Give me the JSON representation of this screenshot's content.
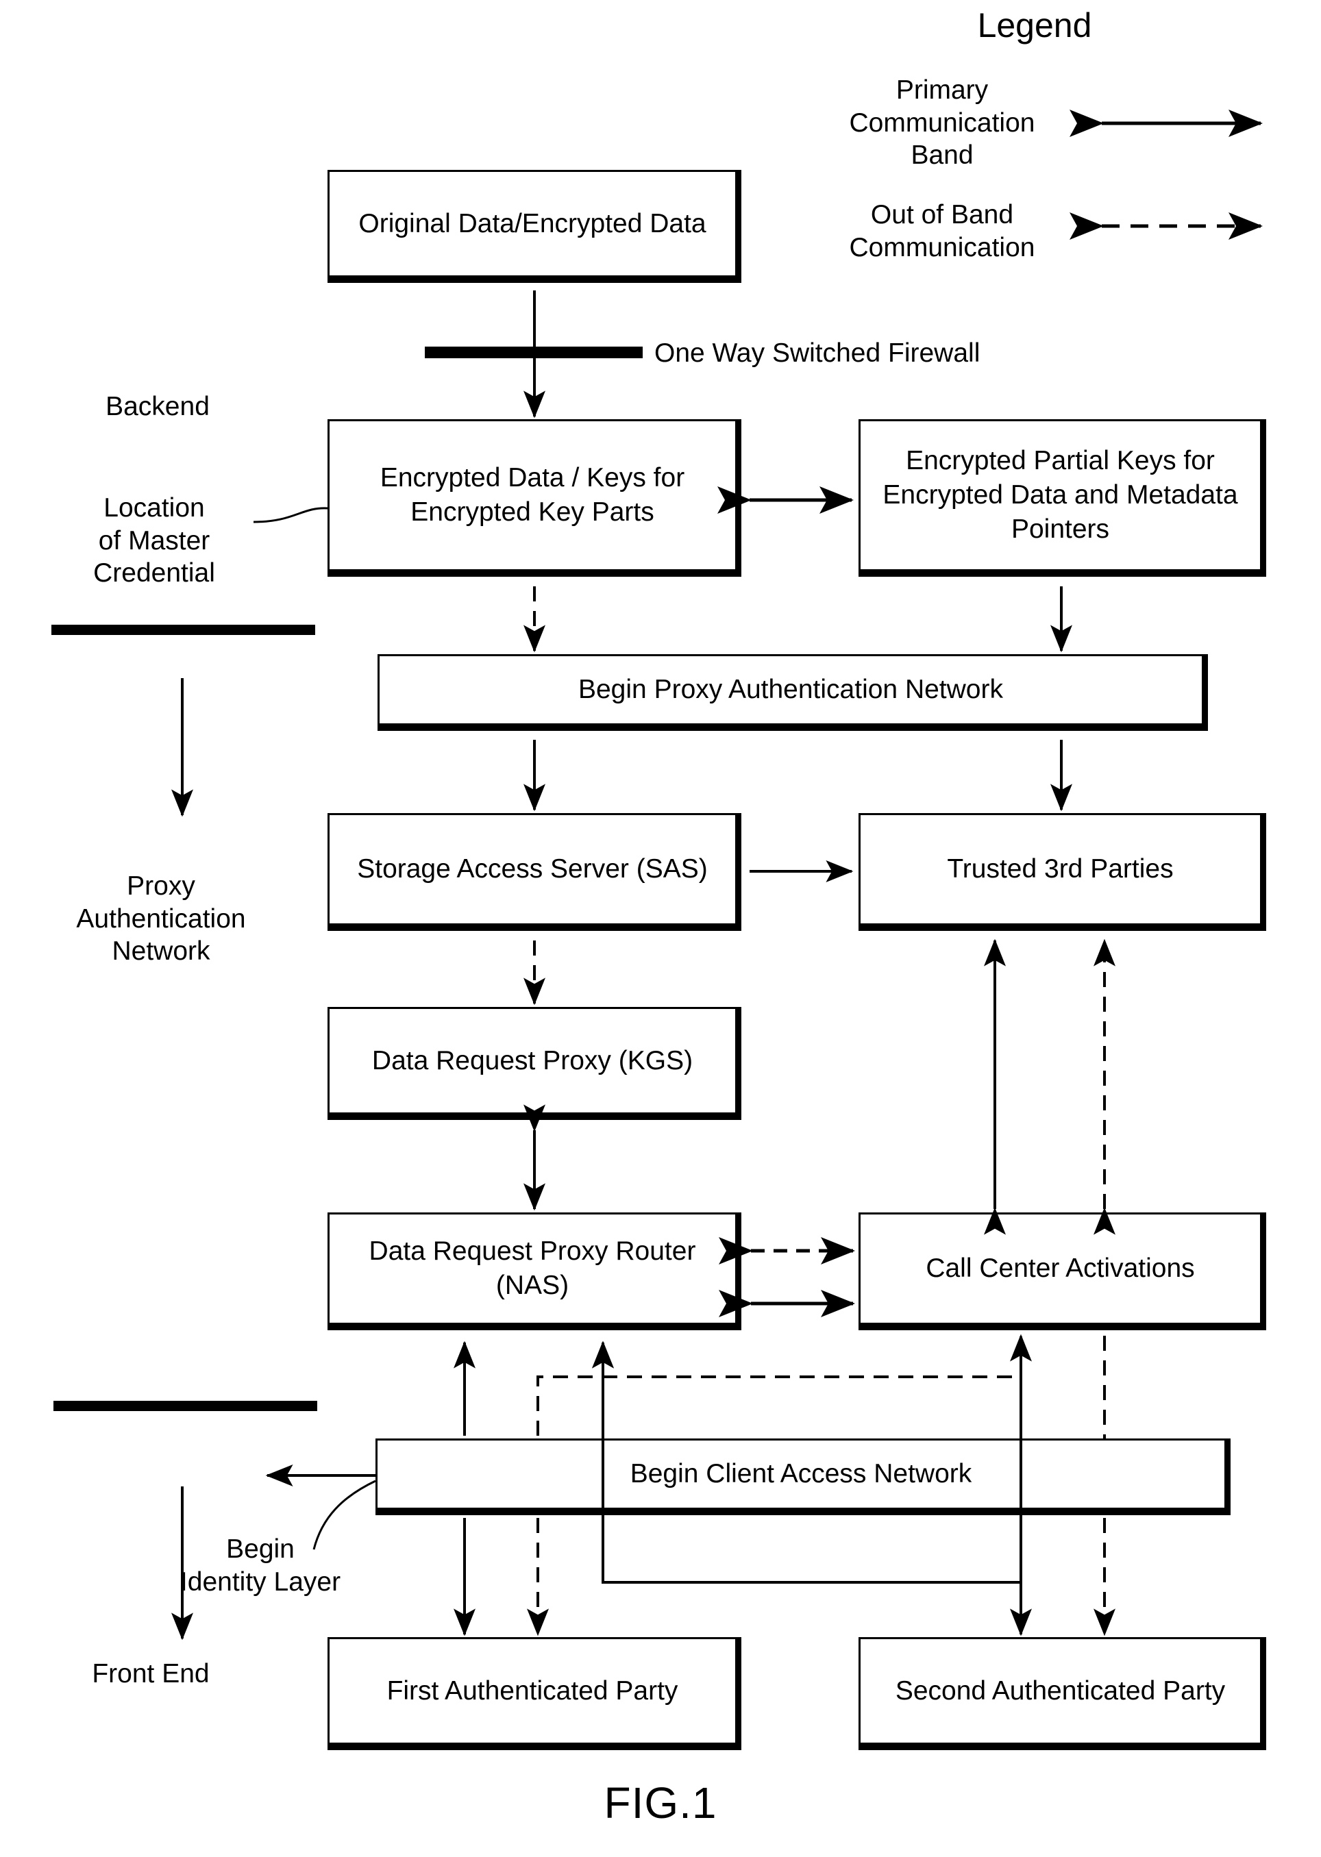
{
  "figure": {
    "caption": "FIG.1"
  },
  "legend": {
    "title": "Legend",
    "items": [
      {
        "label": "Primary\nCommunication\nBand",
        "style": "solid-double-arrow"
      },
      {
        "label": "Out of Band\nCommunication",
        "style": "dashed-double-arrow"
      }
    ]
  },
  "annotations": {
    "firewall": "One Way Switched Firewall",
    "backend": "Backend",
    "location_of_master_credential": "Location\nof Master\nCredential",
    "proxy_authentication_network": "Proxy\nAuthentication\nNetwork",
    "begin_identity_layer": "Begin\nIdentity Layer",
    "front_end": "Front End"
  },
  "nodes": {
    "original_data": "Original\nData/Encrypted Data",
    "encrypted_data_keys": "Encrypted Data / Keys\nfor Encrypted Key Parts",
    "encrypted_partial_keys": "Encrypted Partial Keys\nfor Encrypted Data\nand Metadata Pointers",
    "begin_proxy_auth_network": "Begin Proxy Authentication Network",
    "storage_access_server": "Storage Access Server\n(SAS)",
    "trusted_3rd_parties": "Trusted 3rd Parties",
    "data_request_proxy_kgs": "Data Request Proxy\n(KGS)",
    "data_request_proxy_router_nas": "Data Request Proxy\nRouter (NAS)",
    "call_center_activations": "Call Center Activations",
    "begin_client_access_network": "Begin Client Access Network",
    "first_authenticated_party": "First Authenticated\nParty",
    "second_authenticated_party": "Second Authenticated\nParty"
  },
  "colors": {
    "ink": "#000000",
    "paper": "#ffffff"
  }
}
